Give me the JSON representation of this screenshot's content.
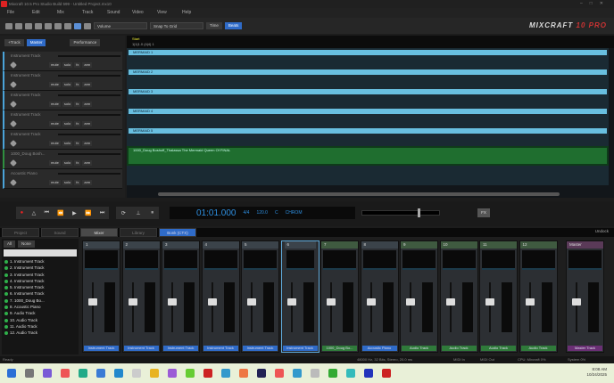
{
  "window": {
    "title": "Mixcraft 10.5 Pro Studio Build 599 - Untitled Project.mx10"
  },
  "menu": [
    "File",
    "Edit",
    "Mix",
    "Track",
    "Sound",
    "Video",
    "View",
    "Help"
  ],
  "toolbar": {
    "automation_select": "Volume",
    "snap_select": "Snap To Grid",
    "time_button": "Time",
    "beats_button": "Beats"
  },
  "logo": {
    "text": "MIXCRAFT",
    "version": "10 PRO"
  },
  "track_panel": {
    "add_track": "+Track",
    "master": "Master",
    "performance": "Performance"
  },
  "ruler": {
    "marker": "Start",
    "position": "1|1|1.0 (4|4) 1"
  },
  "tracks": [
    {
      "name": "Instrument Track",
      "clip": "MERMAID 1",
      "type": "instrument"
    },
    {
      "name": "Instrument Track",
      "clip": "MERMAID 2",
      "type": "instrument"
    },
    {
      "name": "Instrument Track",
      "clip": "MERMAID 3",
      "type": "instrument"
    },
    {
      "name": "Instrument Track",
      "clip": "MERMAID 4",
      "type": "instrument"
    },
    {
      "name": "Instrument Track",
      "clip": "MERMAID 5",
      "type": "instrument"
    },
    {
      "name": "1000_Doug Bosh...",
      "clip": "1000_Doug Boshoff_Thalassa The Mermaid Queen Of FINAL",
      "type": "audio"
    },
    {
      "name": "Acoustic Piano",
      "clip": "",
      "type": "instrument"
    }
  ],
  "track_buttons": [
    "mute",
    "solo",
    "fx",
    "arm"
  ],
  "transport": {
    "time": "01:01.000",
    "signature": "4/4",
    "tempo": "120.0",
    "key": "C",
    "chords": "CHROM",
    "fx_label": "FX"
  },
  "tabs": [
    {
      "label": "Project"
    },
    {
      "label": "Sound"
    },
    {
      "label": "Mixer",
      "active": true
    },
    {
      "label": "Library"
    },
    {
      "label": "Bonk (CTX)",
      "highlight": true
    }
  ],
  "mixer": {
    "list_buttons": [
      "All",
      "None"
    ],
    "list": [
      "1. Instrument Track",
      "2. Instrument Track",
      "3. Instrument Track",
      "4. Instrument Track",
      "5. Instrument Track",
      "6. Instrument Track",
      "7. 1000_Doug Bo...",
      "8. Acoustic Piano",
      "9. Audio Track",
      "10. Audio Track",
      "11. Audio Track",
      "12. Audio Track"
    ],
    "channels": [
      {
        "num": "1",
        "label": "Instrument Track",
        "type": "instrument"
      },
      {
        "num": "2",
        "label": "Instrument Track",
        "type": "instrument"
      },
      {
        "num": "3",
        "label": "Instrument Track",
        "type": "instrument"
      },
      {
        "num": "4",
        "label": "Instrument Track",
        "type": "instrument"
      },
      {
        "num": "5",
        "label": "Instrument Track",
        "type": "instrument"
      },
      {
        "num": "6",
        "label": "Instrument Track",
        "type": "instrument",
        "selected": true
      },
      {
        "num": "7",
        "label": "1000_Doug Bo...",
        "type": "audio"
      },
      {
        "num": "8",
        "label": "Acoustic Piano",
        "type": "instrument"
      },
      {
        "num": "9",
        "label": "Audio Track",
        "type": "audio"
      },
      {
        "num": "10",
        "label": "Audio Track",
        "type": "audio"
      },
      {
        "num": "11",
        "label": "Audio Track",
        "type": "audio"
      },
      {
        "num": "12",
        "label": "Audio Track",
        "type": "audio"
      }
    ],
    "master": {
      "num": "Master",
      "label": "Master Track"
    },
    "undock": "Undock"
  },
  "status": {
    "left": "Ready",
    "audio": "48000 Hz, 32 Bits, Stereo, 20.0 ms",
    "midi_in": "MIDI In",
    "midi_out": "MIDI Out",
    "cpu": "CPU: Mixcraft 0%",
    "system": "System 0%"
  },
  "taskbar": {
    "time": "8:08 AM",
    "date": "10/24/2025"
  },
  "colors": {
    "instrument": "#68bfe0",
    "audio": "#2f7a3a",
    "master": "#6a2f74",
    "accent": "#2f6bc8"
  }
}
